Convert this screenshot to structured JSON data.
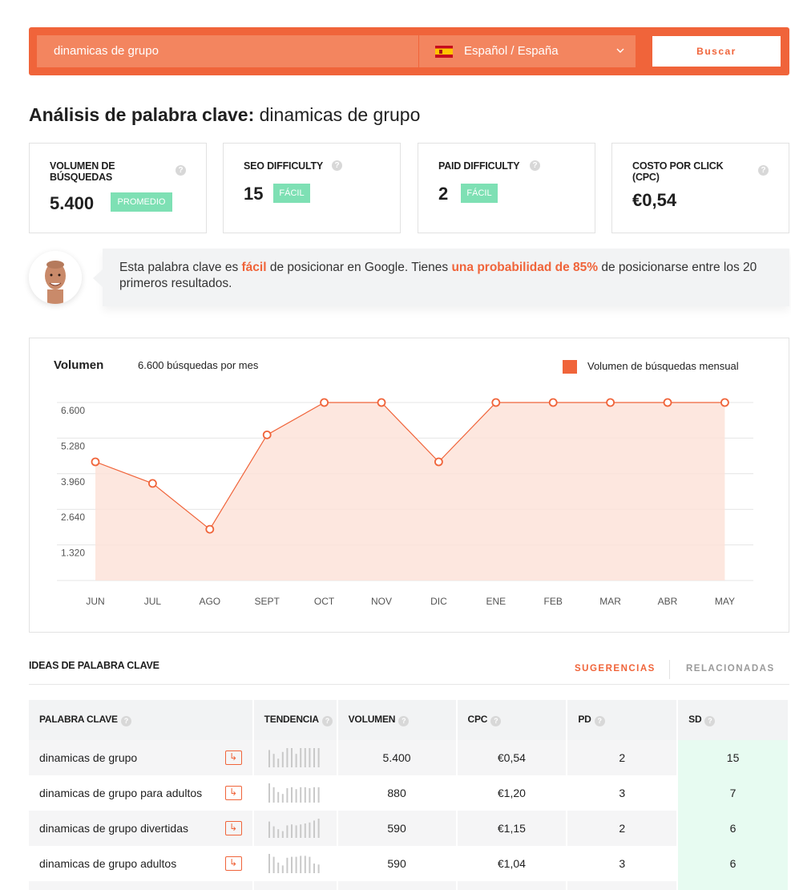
{
  "search": {
    "keyword_value": "dinamicas de grupo",
    "language_label": "Español / España",
    "button_label": "Buscar"
  },
  "page_title": {
    "prefix": "Análisis de palabra clave:",
    "keyword": "dinamicas de grupo"
  },
  "metrics": [
    {
      "label": "Volumen de búsquedas",
      "value": "5.400",
      "badge": "PROMEDIO"
    },
    {
      "label": "SEO Difficulty",
      "value": "15",
      "badge": "FÁCIL"
    },
    {
      "label": "Paid Difficulty",
      "value": "2",
      "badge": "FÁCIL"
    },
    {
      "label": "Costo por click (CPC)",
      "value": "€0,54",
      "badge": ""
    }
  ],
  "advice": {
    "part1": "Esta palabra clave es ",
    "highlight1": "fácil",
    "part2": " de posicionar en Google. Tienes ",
    "highlight2": "una probabilidad de 85%",
    "part3": " de posicionarse entre los 20 primeros resultados."
  },
  "chart": {
    "title": "Volumen",
    "subtitle": "6.600 búsquedas por mes",
    "legend": "Volumen de búsquedas mensual"
  },
  "chart_data": {
    "type": "area",
    "categories": [
      "JUN",
      "JUL",
      "AGO",
      "SEPT",
      "OCT",
      "NOV",
      "DIC",
      "ENE",
      "FEB",
      "MAR",
      "ABR",
      "MAY"
    ],
    "series": [
      {
        "name": "Volumen de búsquedas mensual",
        "values": [
          4400,
          3600,
          1900,
          5400,
          6600,
          6600,
          4400,
          6600,
          6600,
          6600,
          6600,
          6600
        ]
      }
    ],
    "yticks": [
      "1.320",
      "2.640",
      "3.960",
      "5.280",
      "6.600"
    ],
    "ylim": [
      0,
      6600
    ],
    "grid": true,
    "legend_position": "top-right",
    "color": "#f0643a",
    "fill": "#fde3d9"
  },
  "ideas": {
    "title": "IDEAS DE PALABRA CLAVE",
    "tab_active": "SUGERENCIAS",
    "tab_inactive": "RELACIONADAS",
    "columns": [
      "PALABRA CLAVE",
      "TENDENCIA",
      "VOLUMEN",
      "CPC",
      "PD",
      "SD"
    ],
    "rows": [
      {
        "keyword": "dinamicas de grupo",
        "volume": "5.400",
        "cpc": "€0,54",
        "pd": "2",
        "sd": "15",
        "trend": [
          0.9,
          0.7,
          0.45,
          0.8,
          1,
          1,
          0.7,
          1,
          1,
          1,
          1,
          1
        ]
      },
      {
        "keyword": "dinamicas de grupo para adultos",
        "volume": "880",
        "cpc": "€1,20",
        "pd": "3",
        "sd": "7",
        "trend": [
          1,
          0.8,
          0.55,
          0.45,
          0.75,
          0.8,
          0.7,
          0.8,
          0.8,
          0.75,
          0.8,
          0.8
        ]
      },
      {
        "keyword": "dinamicas de grupo divertidas",
        "volume": "590",
        "cpc": "€1,15",
        "pd": "2",
        "sd": "6",
        "trend": [
          0.85,
          0.6,
          0.45,
          0.35,
          0.65,
          0.7,
          0.65,
          0.7,
          0.75,
          0.8,
          0.9,
          1
        ]
      },
      {
        "keyword": "dinamicas de grupo adultos",
        "volume": "590",
        "cpc": "€1,04",
        "pd": "3",
        "sd": "6",
        "trend": [
          1,
          0.85,
          0.55,
          0.4,
          0.8,
          0.85,
          0.85,
          0.9,
          0.9,
          0.85,
          0.5,
          0.45
        ]
      }
    ]
  }
}
